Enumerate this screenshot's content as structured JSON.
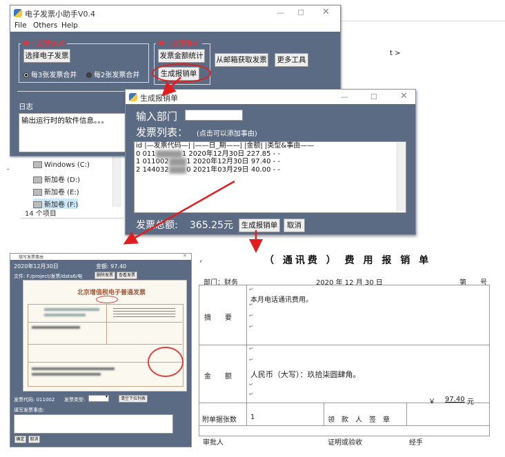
{
  "explorer": {
    "drives": [
      "Windows (C:)",
      "新加卷 (D:)",
      "新加卷 (E:)",
      "新加卷 (F:)"
    ],
    "item_count": "14 个项目",
    "right_fragment": "t >"
  },
  "main_window": {
    "title": "电子发票小助手V0.4",
    "menu": [
      "File",
      "Others",
      "Help"
    ],
    "merge_group": {
      "title": "电子发票合并",
      "select_button": "选择电子发票",
      "radio_3": "每3张发票合并",
      "radio_2": "每2张发票合并"
    },
    "process_group": {
      "title": "电子发票处理",
      "stats_button": "发票金额统计",
      "report_button": "生成报销单"
    },
    "email_button": "从邮箱获取发票",
    "more_button": "更多工具",
    "log_label": "日志",
    "log_text": "输出运行时的软件信息。。。"
  },
  "dialog": {
    "title": "生成报销单",
    "department_label": "输入部门",
    "department_value": "",
    "invoice_list_label": "发票列表：",
    "invoice_list_hint": "(点击可以添加事由)",
    "list_header": "id |—发票代码—| |——日_期——| |金额| |类型&事由——",
    "rows": [
      {
        "id": "0",
        "code_visible": "011",
        "code_tail": "1",
        "date": "2020年12月30日",
        "amount": "227.85",
        "extra": "- -"
      },
      {
        "id": "1",
        "code_visible": "011002",
        "code_tail": "1",
        "date": "2020年12月30日",
        "amount": "97.40",
        "extra": "- -"
      },
      {
        "id": "2",
        "code_visible": "144032",
        "code_tail": "0",
        "date": "2021年03月29日",
        "amount": "40.00",
        "extra": "- -"
      }
    ],
    "total_label": "发票总额:",
    "total_value": "365.25元",
    "generate_button": "生成报销单",
    "cancel_button": "取消"
  },
  "invoice_window": {
    "title": "填写发票事由",
    "date": "2020年12月30日",
    "amount": "金额: 97.40",
    "file_label": "文件: F:/project/发票/data6/电",
    "delete_button": "删除发票",
    "view_button": "查看发票",
    "invoice_heading": "北京增值税电子普通发票",
    "code_label": "发票代码: 011002",
    "type_label": "发票类型:",
    "clear_button": "清空下拉列表",
    "reason_label": "填写发票事由:",
    "ok_button": "确定",
    "cancel_button": "取消"
  },
  "expense_form": {
    "title_open": "（",
    "title_category": "通讯费",
    "title_close": "）",
    "title_suffix": "费 用 报 销 单",
    "department": "部门：财务",
    "date": "2020 年 12 月 30 日",
    "number_label": "第　　号",
    "summary_label": "摘　　要",
    "summary_text": "本月电话通讯费用。",
    "amount_label": "金　　额",
    "amount_words": "人民币（大写）：玖拾柒圆肆角。",
    "amount_symbol": "￥",
    "amount_number": "97.40",
    "amount_unit": "元",
    "attach_label": "附单据张数",
    "attach_value": "1",
    "receiver_label": "领　款　人　签　章",
    "approver": "审批人",
    "verifier": "证明或验收",
    "handler": "经手"
  }
}
